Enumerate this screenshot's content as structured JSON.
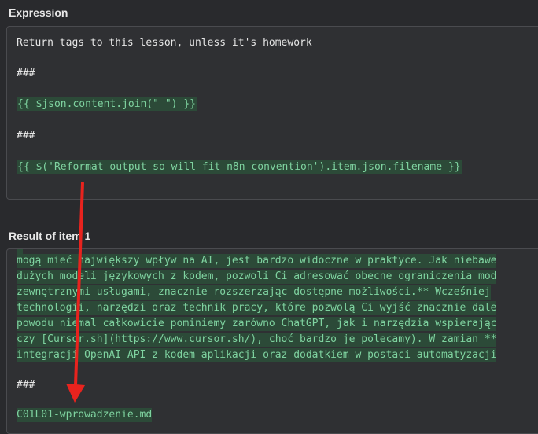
{
  "expression": {
    "label": "Expression",
    "lines": [
      "Return tags to this lesson, unless it's homework",
      "###",
      "{{ $json.content.join(\" \") }}",
      "###",
      "{{ $('Reformat output so will fit n8n convention').item.json.filename }}"
    ]
  },
  "result": {
    "label": "Result of item 1",
    "lines": [
      "mogą mieć największy wpływ na AI, jest bardzo widoczne w praktyce. Jak niebawe",
      "dużych modeli językowych z kodem, pozwoli Ci adresować obecne ograniczenia mod",
      "zewnętrznymi usługami, znacznie rozszerzając dostępne możliwości.** Wcześniej",
      "technologii, narzędzi oraz technik pracy, które pozwolą Ci wyjść znacznie dale",
      "powodu niemal całkowicie pominiemy zarówno ChatGPT, jak i narzędzia wspierając",
      "czy [Cursor.sh](https://www.cursor.sh/), choć bardzo je polecamy). W zamian **",
      "integracji OpenAI API z kodem aplikacji oraz dodatkiem w postaci automatyzacji",
      "###",
      "C01L01-wprowadzenie.md"
    ]
  },
  "annotation": {
    "arrow_color": "#e8231e"
  }
}
